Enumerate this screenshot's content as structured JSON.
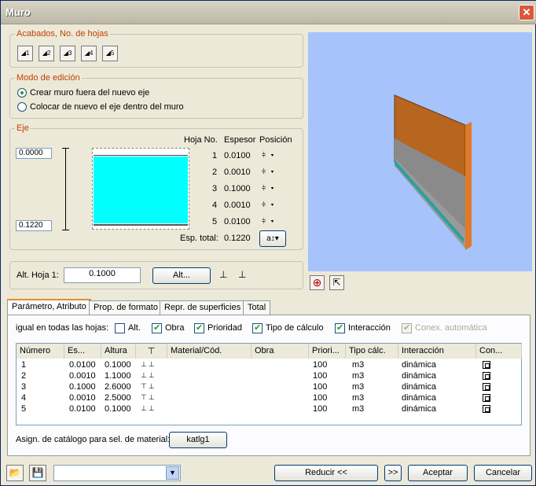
{
  "window": {
    "title": "Muro",
    "close_icon": "close-icon"
  },
  "acabados": {
    "title": "Acabados, No. de hojas",
    "buttons": [
      "1",
      "2",
      "3",
      "4",
      "5"
    ]
  },
  "modo": {
    "title": "Modo de edición",
    "opt1": "Crear muro fuera del nuevo eje",
    "opt2": "Colocar de nuevo el eje dentro del muro",
    "selected": 1
  },
  "eje": {
    "title": "Eje",
    "top_value": "0.0000",
    "bottom_value": "0.1220",
    "col_hoja": "Hoja No.",
    "col_espesor": "Espesor",
    "col_posicion": "Posición",
    "rows": [
      {
        "n": "1",
        "esp": "0.0100"
      },
      {
        "n": "2",
        "esp": "0.0010"
      },
      {
        "n": "3",
        "esp": "0.1000"
      },
      {
        "n": "4",
        "esp": "0.0010"
      },
      {
        "n": "5",
        "esp": "0.0100"
      }
    ],
    "total_label": "Esp. total:",
    "total_value": "0.1220",
    "total_btn": "a"
  },
  "alt": {
    "label": "Alt. Hoja 1:",
    "value": "0.1000",
    "button": "Alt..."
  },
  "tabs": [
    "Parámetro, Atributo",
    "Prop. de formato",
    "Repr. de superficies",
    "Total"
  ],
  "igual": {
    "label": "igual en todas las hojas:",
    "alt": "Alt.",
    "obra": "Obra",
    "prioridad": "Prioridad",
    "tipo": "Tipo de cálculo",
    "interaccion": "Interacción",
    "conex": "Conex. automática",
    "checked": {
      "alt": false,
      "obra": true,
      "prioridad": true,
      "tipo": true,
      "interaccion": true,
      "conex": true
    }
  },
  "table": {
    "headers": [
      "Número",
      "Es...",
      "Altura",
      "",
      "Material/Cód.",
      "Obra",
      "Priori...",
      "Tipo cálc.",
      "Interacción",
      "Con..."
    ],
    "rows": [
      {
        "num": "1",
        "es": "0.0100",
        "alt": "0.1000",
        "pri": "100",
        "tipo": "m3",
        "inter": "dinámica"
      },
      {
        "num": "2",
        "es": "0.0010",
        "alt": "1.1000",
        "pri": "100",
        "tipo": "m3",
        "inter": "dinámica"
      },
      {
        "num": "3",
        "es": "0.1000",
        "alt": "2.6000",
        "pri": "100",
        "tipo": "m3",
        "inter": "dinámica"
      },
      {
        "num": "4",
        "es": "0.0010",
        "alt": "2.5000",
        "pri": "100",
        "tipo": "m3",
        "inter": "dinámica"
      },
      {
        "num": "5",
        "es": "0.0100",
        "alt": "0.1000",
        "pri": "100",
        "tipo": "m3",
        "inter": "dinámica"
      }
    ]
  },
  "catalogo": {
    "label": "Asign. de catálogo para sel. de material:",
    "button": "katlg1"
  },
  "bottom": {
    "reducir": "Reducir <<",
    "arrow": ">>",
    "aceptar": "Aceptar",
    "cancelar": "Cancelar",
    "combo_value": ""
  },
  "colors": {
    "accent": "#c04000",
    "preview_bg": "#a6c3fb",
    "wall_top": "#b86520",
    "wall_mid": "#8a8a8a",
    "layer_cyan": "#00ffff"
  }
}
